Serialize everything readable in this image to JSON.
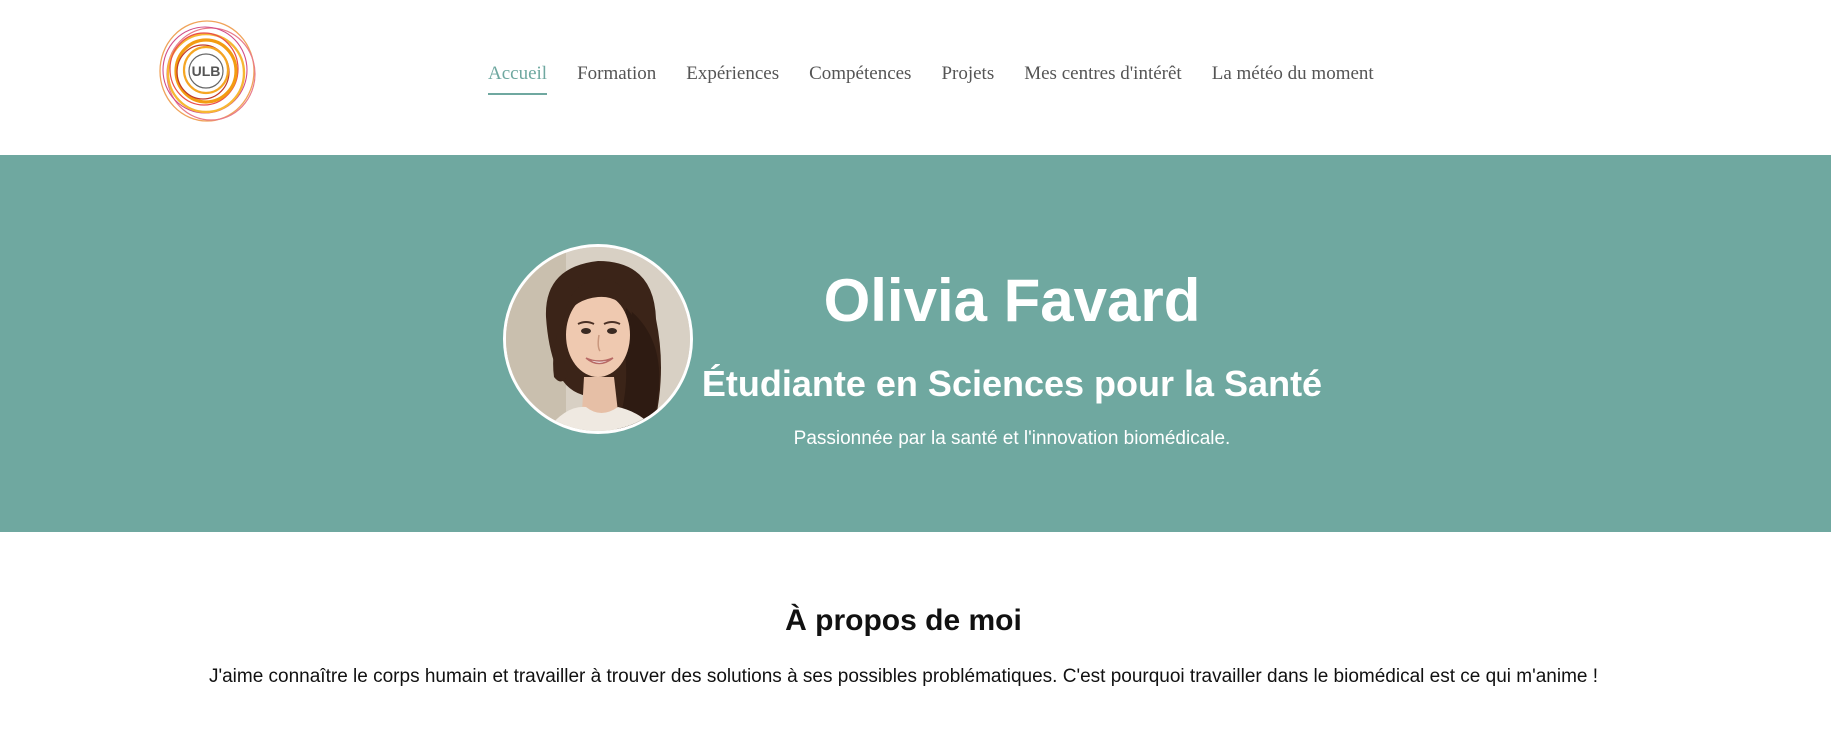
{
  "logo": {
    "text": "ULB",
    "icon": "university-logo"
  },
  "nav": {
    "items": [
      {
        "label": "Accueil",
        "active": true
      },
      {
        "label": "Formation",
        "active": false
      },
      {
        "label": "Expériences",
        "active": false
      },
      {
        "label": "Compétences",
        "active": false
      },
      {
        "label": "Projets",
        "active": false
      },
      {
        "label": "Mes centres d'intérêt",
        "active": false
      },
      {
        "label": "La météo du moment",
        "active": false
      }
    ]
  },
  "hero": {
    "name": "Olivia Favard",
    "title": "Étudiante en Sciences pour la Santé",
    "tagline": "Passionnée par la santé et l'innovation biomédicale.",
    "avatar_icon": "profile-photo"
  },
  "about": {
    "title": "À propos de moi",
    "text": "J'aime connaître le corps humain et travailler à trouver des solutions à ses possibles problématiques. C'est pourquoi travailler dans le biomédical est ce qui m'anime !"
  },
  "colors": {
    "accent": "#6fa8a0",
    "nav_text": "#555555",
    "body_text": "#111111",
    "background": "#ffffff"
  }
}
